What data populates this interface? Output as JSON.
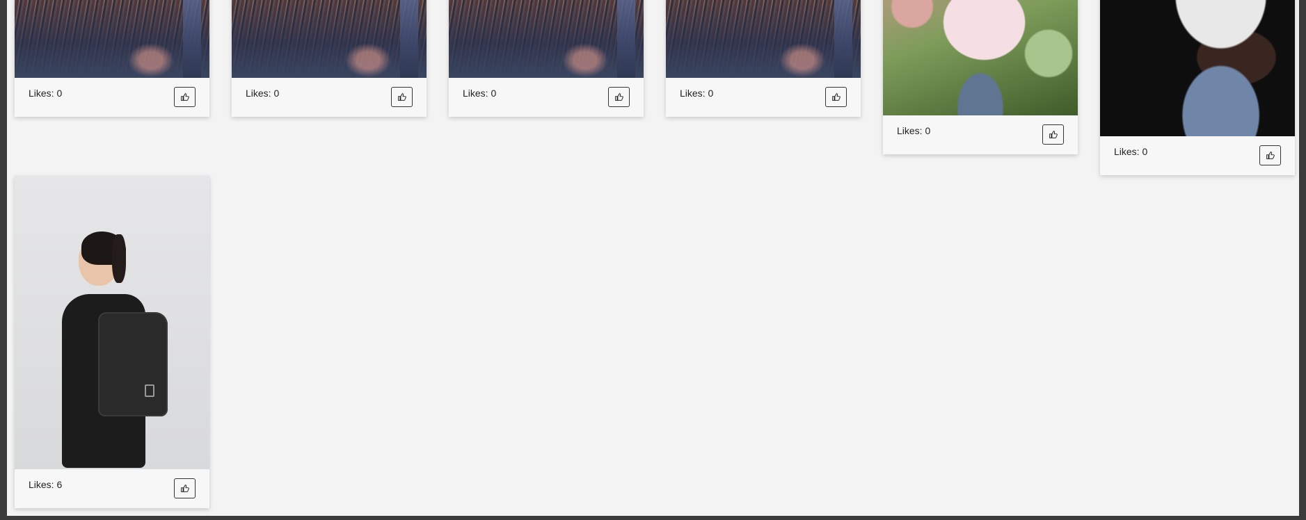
{
  "cards": [
    {
      "likes_label": "Likes: 0",
      "like_icon": "thumbs-up-icon"
    },
    {
      "likes_label": "Likes: 0",
      "like_icon": "thumbs-up-icon"
    },
    {
      "likes_label": "Likes: 0",
      "like_icon": "thumbs-up-icon"
    },
    {
      "likes_label": "Likes: 0",
      "like_icon": "thumbs-up-icon"
    },
    {
      "likes_label": "Likes: 0",
      "like_icon": "thumbs-up-icon"
    },
    {
      "likes_label": "Likes: 0",
      "like_icon": "thumbs-up-icon"
    },
    {
      "likes_label": "Likes: 6",
      "like_icon": "thumbs-up-icon"
    }
  ]
}
